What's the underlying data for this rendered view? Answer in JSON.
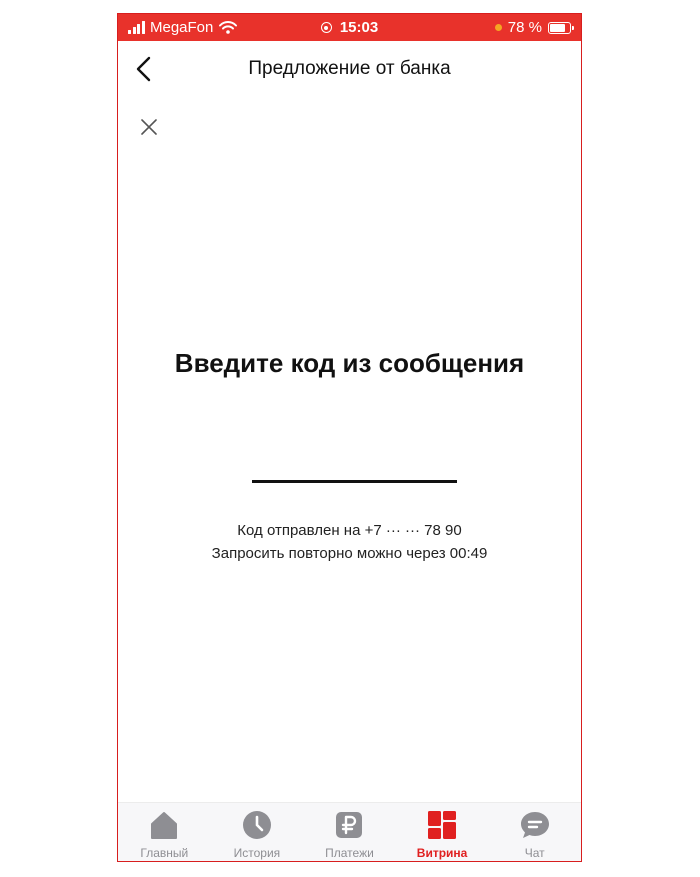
{
  "status_bar": {
    "carrier": "MegaFon",
    "time": "15:03",
    "battery": "78 %",
    "battery_level": 0.78,
    "dot_color": "#f5a623"
  },
  "header": {
    "title": "Предложение от банка"
  },
  "main": {
    "heading": "Введите код из сообщения",
    "code_value": "",
    "sent_to": "Код отправлен на +7 ··· ··· 78 90",
    "resend": "Запросить повторно можно через 00:49"
  },
  "tabs": [
    {
      "label": "Главный",
      "icon": "home-icon"
    },
    {
      "label": "История",
      "icon": "clock-icon"
    },
    {
      "label": "Платежи",
      "icon": "ruble-icon"
    },
    {
      "label": "Витрина",
      "icon": "showcase-icon",
      "active": true
    },
    {
      "label": "Чат",
      "icon": "chat-icon"
    }
  ],
  "colors": {
    "accent": "#e8322b",
    "active_tab": "#e02020",
    "inactive_tab": "#8e8e93"
  }
}
